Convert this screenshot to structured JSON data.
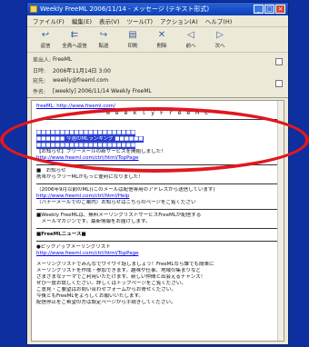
{
  "window": {
    "title": "Weekly FreeML 2006/11/14 - メッセージ (テキスト形式)"
  },
  "menu": [
    "ファイル(F)",
    "編集(E)",
    "表示(V)",
    "ツール(T)",
    "アクション(A)",
    "ヘルプ(H)"
  ],
  "toolbar": [
    {
      "label": "返信",
      "icon": "reply-icon"
    },
    {
      "label": "全員へ返信",
      "icon": "reply-all-icon"
    },
    {
      "label": "転送",
      "icon": "forward-icon"
    },
    {
      "label": "印刷",
      "icon": "print-icon"
    },
    {
      "label": "削除",
      "icon": "delete-icon"
    },
    {
      "label": "前へ",
      "icon": "prev-icon"
    },
    {
      "label": "次へ",
      "icon": "next-icon"
    }
  ],
  "headers": [
    {
      "label": "差出人:",
      "value": "FreeML"
    },
    {
      "label": "日時:",
      "value": "2006年11月14日 3:00"
    },
    {
      "label": "宛先:",
      "value": "weekly@freeml.com"
    },
    {
      "label": "件名:",
      "value": "[weekly] 2006/11/14 Weekly FreeML"
    }
  ],
  "body": {
    "top_link": "freeML: http://www.freeml.com/",
    "logo": "W e e k l y   F r e e M L",
    "highlight_lines": [
      "■■■■■■■■■■■■■■■■■■■■■",
      "■■■■■■ 今週のMLランキング ■■■■■■",
      "■■■■■■■■■■■■■■■■■■■■■"
    ],
    "promo_line": "【お知らせ】フリーメールの新サービスを開始しました！",
    "promo_link": "http://www.freeml.com/ctrl/html/TopPage",
    "notice_title": "■　お知らせ",
    "notice_text": "携帯からフリーMLがもっと便利になりました！",
    "info_line": "（2006年9月以前のML)(このメールは配信専用のアドレスから送信しています)",
    "info_link": "http://www.freeml.com/ctrl/html/Help",
    "banner": "（バナーメールでのご案内）お知らせはこちらのページをご覧ください",
    "weekly_line1": "■Weekly FreeMLは、無料メーリングリストサービスFreeMLが配信する",
    "weekly_line2": "　メールマガジンです。最新情報をお届けします。",
    "news_title": "■FreeMLニュース■",
    "pickup_title": "●ピックアップメーリングリスト",
    "pickup_link": "http://www.freeml.com/ctrl/html/TopPage",
    "paragraph": [
      "メーリングリストでみんなでワイワイ話しましょう！FreeMLなら誰でも簡単に",
      "メーリングリストを作成・参加できます。趣味や仕事、地域の集まりなど",
      "さまざまなテーマでご利用いただけます。新しい仲間と出会えるチャンス！",
      "ぜひ一度お試しください。詳しくはトップページをご覧ください。",
      "ご意見・ご要望はお問い合わせフォームからお寄せください。",
      "今後ともFreeMLをよろしくお願いいたします。",
      "配信停止をご希望の方は設定ページから手続きしてください。"
    ]
  }
}
